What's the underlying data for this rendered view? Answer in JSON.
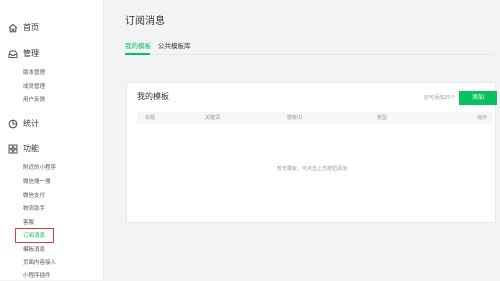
{
  "colors": {
    "accent": "#07c160",
    "highlight": "#e23b3b",
    "background": "#f3f3f5"
  },
  "sidebar": {
    "home": {
      "icon": "home-icon",
      "label": "首页"
    },
    "manage": {
      "icon": "inbox-icon",
      "label": "管理",
      "items": [
        "版本管理",
        "成员管理",
        "用户反馈"
      ]
    },
    "stats": {
      "icon": "stats-icon",
      "label": "统计"
    },
    "features": {
      "icon": "grid-icon",
      "label": "功能",
      "items": [
        "附近的小程序",
        "微信搜一搜",
        "微信支付",
        "物流助手",
        "客服",
        "订阅消息",
        "模板消息",
        "页面内容接入",
        "小程序插件"
      ],
      "active_item": "订阅消息"
    }
  },
  "main": {
    "title": "订阅消息",
    "tabs": [
      {
        "label": "我的模板",
        "active": true
      },
      {
        "label": "公共模板库",
        "active": false
      }
    ],
    "card": {
      "title": "我的模板",
      "hint": "还可添加25个",
      "add_label": "添加",
      "columns": [
        "标题",
        "关键词",
        "模板ID",
        "类型",
        "操作"
      ],
      "empty_text": "暂无模板，可点击上方按钮添加"
    }
  }
}
